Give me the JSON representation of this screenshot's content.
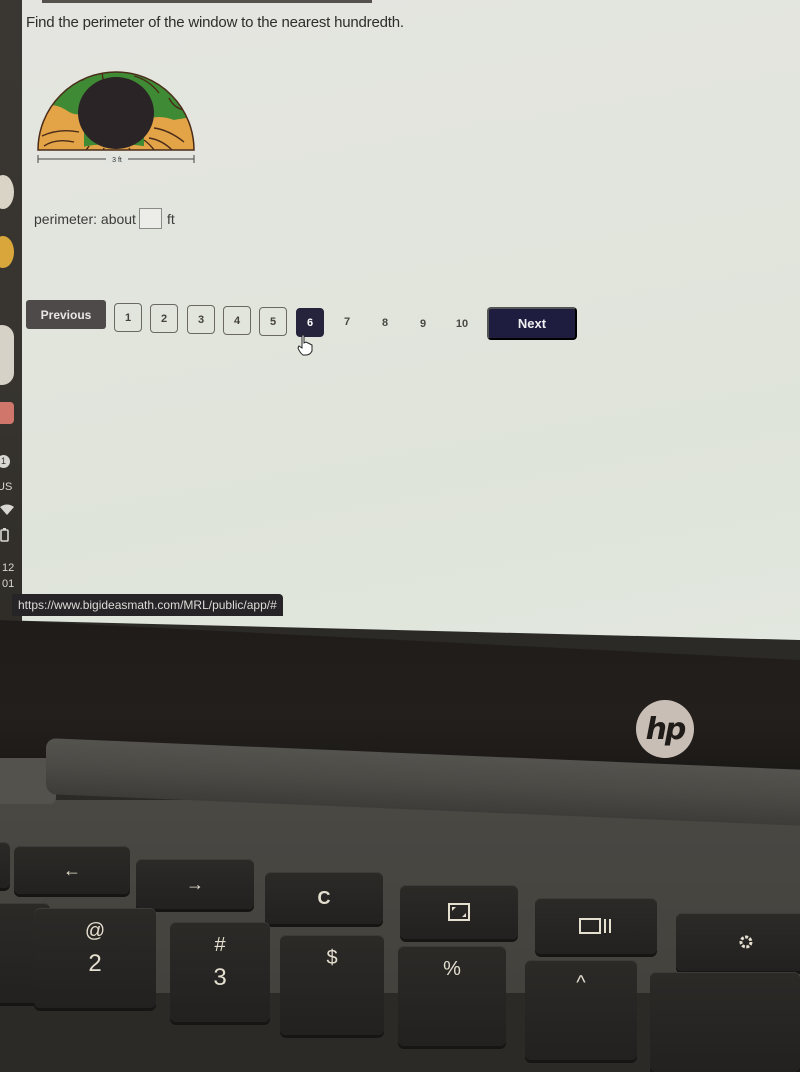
{
  "shelf": {
    "tray": {
      "notification_count": "1",
      "input_language": "US",
      "clock_hour": "12",
      "clock_minute": "01"
    }
  },
  "question": {
    "prompt": "Find the perimeter of the window to the nearest hundredth.",
    "figure": {
      "description": "semicircular stained-glass window",
      "dimension_label": "3 ft",
      "colors": {
        "green": "#3f8a34",
        "orange": "#e3a347",
        "dark": "#2a2426",
        "outline": "#4a2c1a"
      }
    },
    "answer": {
      "label": "perimeter: about",
      "value": "",
      "placeholder": "",
      "unit": "ft"
    }
  },
  "pagination": {
    "previous_label": "Previous",
    "next_label": "Next",
    "current_page": 6,
    "boxed_pages": [
      "1",
      "2",
      "3",
      "4",
      "5",
      "6"
    ],
    "plain_pages": [
      "7",
      "8",
      "9",
      "10"
    ],
    "colors": {
      "active": "#26233d",
      "next": "#1f1d3f",
      "previous": "#4f4a4a"
    }
  },
  "status_bar": {
    "url": "https://www.bigideasmath.com/MRL/public/app/#"
  },
  "laptop": {
    "brand_logo": "hp",
    "keys": [
      {
        "name": "back",
        "glyph": "←"
      },
      {
        "name": "forward",
        "glyph": "→"
      },
      {
        "name": "refresh",
        "glyph": "C"
      },
      {
        "name": "fullscreen",
        "glyph": "◲"
      },
      {
        "name": "overview",
        "glyph": "▭∥"
      },
      {
        "name": "brightness-down",
        "glyph": "✲"
      },
      {
        "name": "2",
        "shift": "@",
        "base": "2"
      },
      {
        "name": "3",
        "shift": "#",
        "base": "3"
      },
      {
        "name": "4",
        "shift": "$",
        "base": ""
      },
      {
        "name": "5",
        "shift": "%",
        "base": ""
      },
      {
        "name": "6",
        "shift": "^",
        "base": ""
      }
    ]
  }
}
